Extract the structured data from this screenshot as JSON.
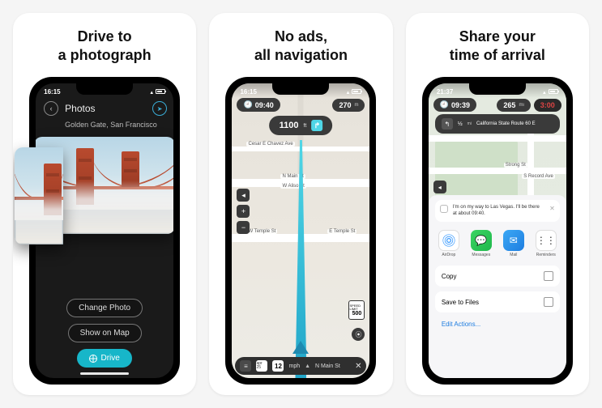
{
  "cards": [
    {
      "title": "Drive to\na photograph"
    },
    {
      "title": "No ads,\nall navigation"
    },
    {
      "title": "Share your\ntime of arrival"
    }
  ],
  "screen1": {
    "status_time": "16:15",
    "header": "Photos",
    "subheader": "Golden Gate, San Francisco",
    "buttons": {
      "change": "Change Photo",
      "show": "Show on Map",
      "drive": "Drive"
    }
  },
  "screen2": {
    "status_time": "16:15",
    "top_left_time": "09:40",
    "top_right_dist": "270",
    "top_right_unit": "m",
    "turn_distance": "1100",
    "turn_unit": "ft",
    "streets": {
      "chavez": "Cesar E Chavez Ave",
      "nmain": "N Main St",
      "walso": "W Aliso St",
      "wtemple": "W Temple St",
      "etemple": "E Temple St"
    },
    "speed_limit_label": "SPEED LIMIT",
    "speed_limit_value": "500",
    "bottom": {
      "date": "apr 25",
      "speed": "12",
      "speed_unit": "mph",
      "street": "N Main St"
    }
  },
  "screen3": {
    "status_time": "21:37",
    "top_left_time": "09:39",
    "top_dist": "265",
    "top_unit": "mi",
    "top_eta": "3:00",
    "banner_dist": "½",
    "banner_unit": "mi",
    "banner_road": "California State Route 60 E",
    "streets": {
      "strong": "Strong St",
      "record": "S Record Ave"
    },
    "sheet": {
      "message": "I'm on my way to Las Vegas. I'll be there at about 09:40.",
      "apps": {
        "airdrop": "AirDrop",
        "messages": "Messages",
        "mail": "Mail",
        "reminders": "Reminders"
      },
      "copy": "Copy",
      "save": "Save to Files",
      "edit": "Edit Actions..."
    }
  }
}
